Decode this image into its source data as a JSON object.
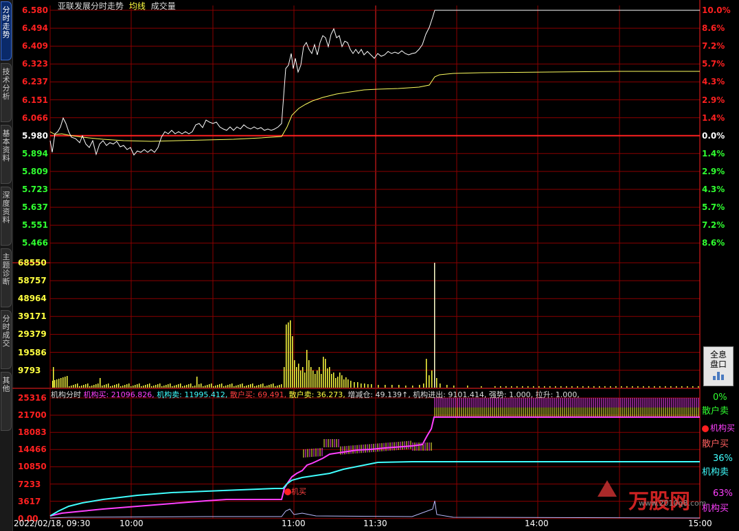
{
  "sidebar_tabs": [
    "分时走势",
    "技术分析",
    "基本资料",
    "深度资料",
    "主题诊断",
    "分时成交",
    "其他"
  ],
  "header": {
    "stock": "亚联发展分时走势",
    "avg": "均线",
    "vol": "成交量"
  },
  "price_axis": [
    "6.580",
    "6.494",
    "6.409",
    "6.323",
    "6.237",
    "6.151",
    "6.066",
    "5.980",
    "5.894",
    "5.809",
    "5.723",
    "5.637",
    "5.551",
    "5.466"
  ],
  "pct_axis": [
    "10.0%",
    "8.6%",
    "7.2%",
    "5.7%",
    "4.3%",
    "2.9%",
    "1.4%",
    "0.0%",
    "1.4%",
    "2.9%",
    "4.3%",
    "5.7%",
    "7.2%",
    "8.6%"
  ],
  "vol_axis": [
    "68550",
    "58757",
    "48964",
    "39171",
    "29379",
    "19586",
    "9793"
  ],
  "inst_axis": [
    "25316",
    "21700",
    "18083",
    "14466",
    "10850",
    "7233",
    "3617",
    "0.00"
  ],
  "info": {
    "name": "机构分时",
    "buy": "机构买: 21096.826,",
    "sell": "机构卖: 11995.412,",
    "rbuy": "散户买: 69.491,",
    "rsell": "散户卖: 36.273,",
    "pos": "增减仓: 49.139↑,",
    "flow": "机构进出: 9101.414,",
    "strong": "强势: 1.000,",
    "rise": "拉升: 1.000,"
  },
  "time_axis": [
    "2022/02/18, 09:30",
    "10:00",
    "11:00",
    "11:30",
    "14:00",
    "15:00"
  ],
  "full_quote": "全息盘口",
  "right_tags": {
    "p0": "0%",
    "sellR": "散户卖",
    "buyInst": "机构买",
    "buyR": "散户买",
    "p36": "36%",
    "sellInst": "机构卖",
    "p63": "63%",
    "buyInst2": "机构买"
  },
  "marker": "机买",
  "watermark": "万股网",
  "watermark_url": "www.2010q8.com",
  "colors": {
    "grid": "#8b0000",
    "red": "#ff2020",
    "green": "#30ff30",
    "yellow": "#ffff40",
    "price": "#ffffff",
    "avg": "#ffff60",
    "cyan": "#40ffff",
    "magenta": "#ff40ff"
  }
}
